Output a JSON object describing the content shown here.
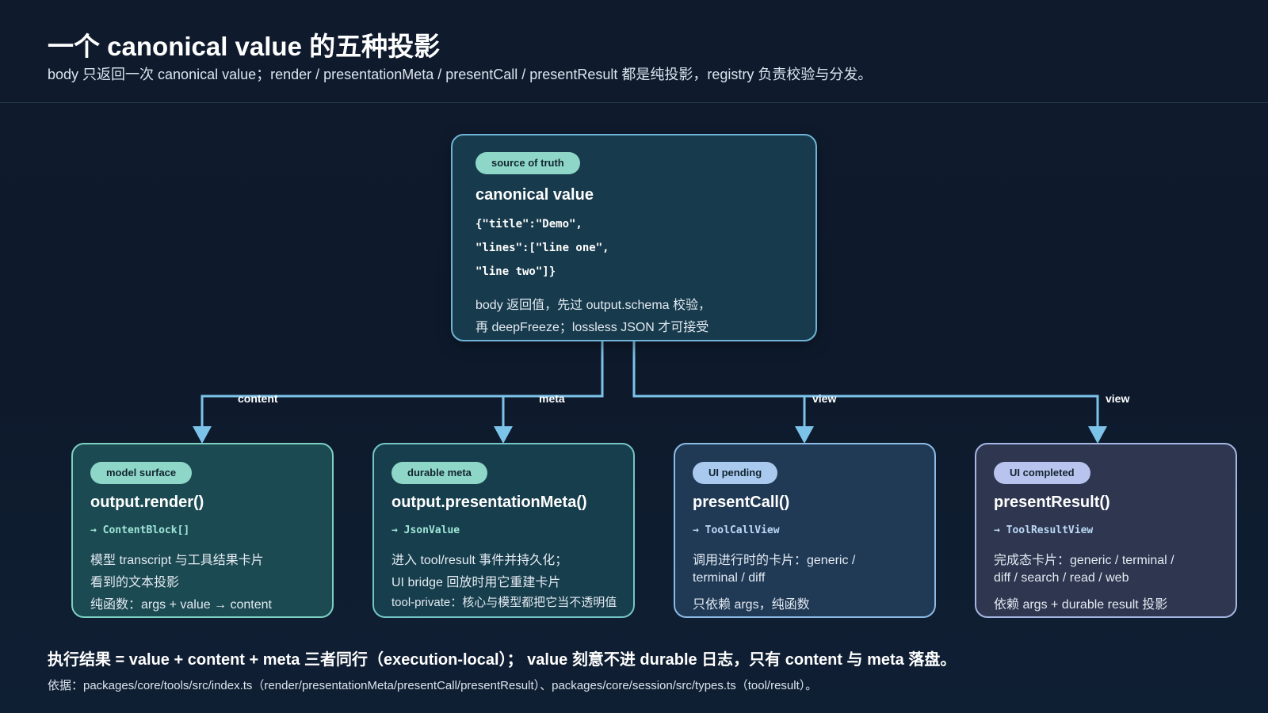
{
  "header": {
    "title": "一个 canonical value 的五种投影",
    "subtitle": "body 只返回一次 canonical value；render / presentationMeta / presentCall / presentResult 都是纯投影，registry 负责校验与分发。"
  },
  "source": {
    "badge": "source of truth",
    "title": "canonical value",
    "code_lines": [
      "{\"title\":\"Demo\",",
      "\"lines\":[\"line one\",",
      "\"line two\"]}"
    ],
    "desc_lines": [
      "body 返回值，先过 output.schema 校验，",
      "再 deepFreeze；lossless JSON 才可接受"
    ]
  },
  "edges": [
    "content",
    "meta",
    "view",
    "view"
  ],
  "projections": [
    {
      "badge": "model surface",
      "title": "output.render()",
      "returns": "→ ContentBlock[]",
      "lines": [
        "模型 transcript 与工具结果卡片",
        "看到的文本投影",
        "纯函数：args + value → content"
      ]
    },
    {
      "badge": "durable meta",
      "title": "output.presentationMeta()",
      "returns": "→ JsonValue",
      "lines": [
        "进入 tool/result 事件并持久化；",
        "UI bridge 回放时用它重建卡片",
        "tool-private：核心与模型都把它当不透明值"
      ]
    },
    {
      "badge": "UI pending",
      "title": "presentCall()",
      "returns": "→ ToolCallView",
      "lines": [
        "调用进行时的卡片：generic /",
        "terminal / diff",
        "只依赖 args，纯函数"
      ]
    },
    {
      "badge": "UI completed",
      "title": "presentResult()",
      "returns": "→ ToolResultView",
      "lines": [
        "完成态卡片：generic / terminal /",
        "diff / search / read / web",
        "依赖 args + durable result 投影"
      ]
    }
  ],
  "footer": {
    "summary": "执行结果 = value + content + meta 三者同行（execution-local）； value 刻意不进 durable 日志，只有 content 与 meta 落盘。",
    "basis": "依据：packages/core/tools/src/index.ts（render/presentationMeta/presentCall/presentResult）、packages/core/session/src/types.ts（tool/result）。"
  },
  "colors": {
    "connector": "#7cc3ea",
    "badge_model": "#8ed6c8",
    "badge_meta": "#8ed6c8",
    "badge_pending": "#a9c9ee",
    "badge_completed": "#b9c4ee"
  }
}
